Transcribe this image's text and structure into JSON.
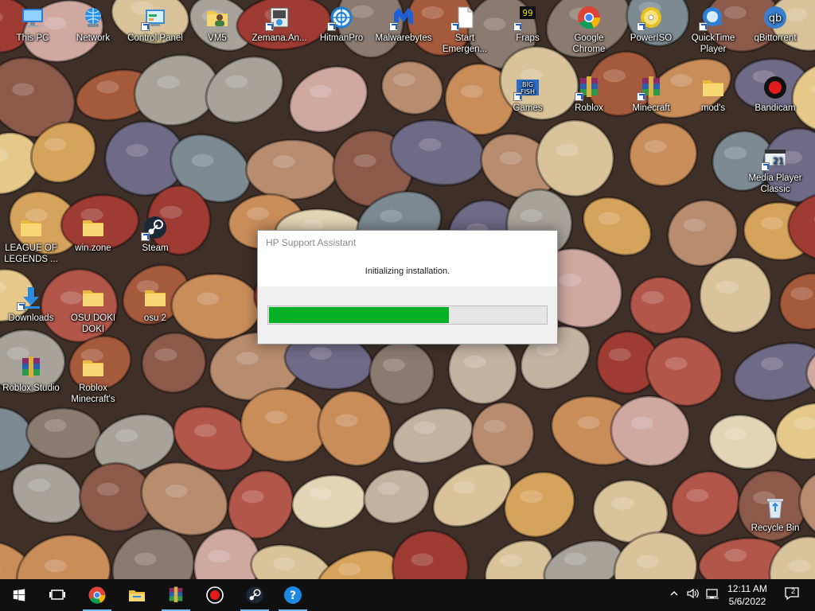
{
  "desktop": {
    "icons": [
      {
        "label": "This PC",
        "icon": "this-pc-icon"
      },
      {
        "label": "Network",
        "icon": "network-icon"
      },
      {
        "label": "Control Panel",
        "icon": "control-panel-icon"
      },
      {
        "label": "VM5",
        "icon": "user-folder-icon"
      },
      {
        "label": "Zemana.An...",
        "icon": "zemana-icon"
      },
      {
        "label": "HitmanPro",
        "icon": "hitmanpro-icon"
      },
      {
        "label": "Malwarebytes",
        "icon": "malwarebytes-icon"
      },
      {
        "label": "Start Emergen...",
        "icon": "document-icon"
      },
      {
        "label": "Fraps",
        "icon": "fraps-icon"
      },
      {
        "label": "Google Chrome",
        "icon": "chrome-icon"
      },
      {
        "label": "PowerISO",
        "icon": "poweriso-icon"
      },
      {
        "label": "QuickTime Player",
        "icon": "quicktime-icon"
      },
      {
        "label": "qBittorrent",
        "icon": "qbittorrent-icon"
      },
      {
        "label": "Games",
        "icon": "bigfish-games-icon"
      },
      {
        "label": "Roblox",
        "icon": "winrar-archive-icon"
      },
      {
        "label": "Minecraft",
        "icon": "winrar-archive-icon"
      },
      {
        "label": "mod's",
        "icon": "folder-icon"
      },
      {
        "label": "Bandicam",
        "icon": "bandicam-icon"
      },
      {
        "label": "Media Player Classic",
        "icon": "media-player-classic-icon"
      },
      {
        "label": "LEAGUE OF LEGENDS ...",
        "icon": "folder-icon"
      },
      {
        "label": "win.zone",
        "icon": "folder-icon"
      },
      {
        "label": "Steam",
        "icon": "steam-icon"
      },
      {
        "label": "Downloads",
        "icon": "downloads-icon"
      },
      {
        "label": "OSU DOKI DOKI",
        "icon": "folder-icon"
      },
      {
        "label": "osu 2",
        "icon": "folder-icon"
      },
      {
        "label": "Roblox Studio",
        "icon": "winrar-archive-icon"
      },
      {
        "label": "Roblox Minecraft's",
        "icon": "folder-icon"
      },
      {
        "label": "Recycle Bin",
        "icon": "recycle-bin-icon"
      }
    ]
  },
  "dialog": {
    "title": "HP Support Assistant",
    "message": "Initializing installation.",
    "progress": 0.65,
    "progress_color": "#06b025"
  },
  "taskbar": {
    "pinned": [
      {
        "icon": "start-icon"
      },
      {
        "icon": "task-view-icon"
      },
      {
        "icon": "chrome-icon"
      },
      {
        "icon": "file-explorer-icon"
      },
      {
        "icon": "winrar-icon"
      },
      {
        "icon": "bandicam-icon"
      },
      {
        "icon": "steam-icon"
      },
      {
        "icon": "hp-support-assistant-icon"
      }
    ],
    "tray_icons": [
      "show-hidden-icons-chevron-icon",
      "volume-icon",
      "network-status-icon"
    ],
    "time": "12:11 AM",
    "date": "5/6/2022",
    "notifications_count": "2"
  }
}
